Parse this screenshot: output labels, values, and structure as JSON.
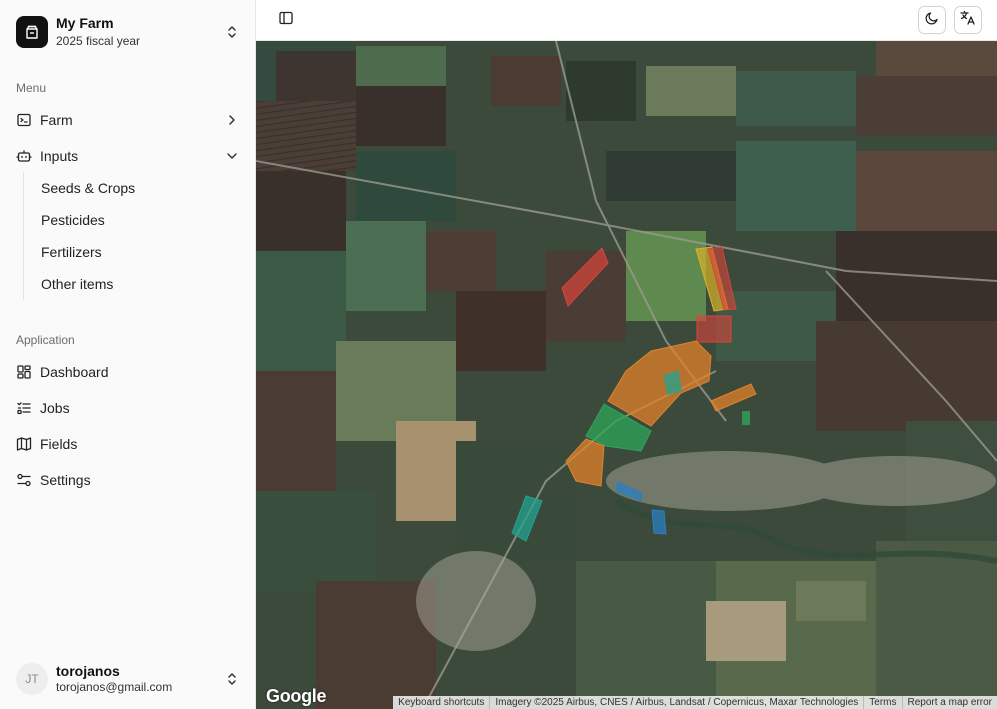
{
  "sidebar": {
    "farm": {
      "name": "My Farm",
      "subtitle": "2025 fiscal year"
    },
    "menu_label": "Menu",
    "menu": [
      {
        "label": "Farm",
        "icon": "terminal-square-icon",
        "chevron": "chevron-right-icon"
      },
      {
        "label": "Inputs",
        "icon": "bot-icon",
        "chevron": "chevron-down-icon",
        "children": [
          "Seeds & Crops",
          "Pesticides",
          "Fertilizers",
          "Other items"
        ]
      }
    ],
    "app_label": "Application",
    "app": [
      {
        "label": "Dashboard",
        "icon": "dashboard-grid-icon"
      },
      {
        "label": "Jobs",
        "icon": "list-todo-icon"
      },
      {
        "label": "Fields",
        "icon": "map-icon"
      },
      {
        "label": "Settings",
        "icon": "sliders-icon"
      }
    ],
    "user": {
      "initials": "JT",
      "name": "torojanos",
      "email": "torojanos@gmail.com"
    }
  },
  "topbar": {
    "toggle_icon": "panel-left-icon",
    "theme_icon": "moon-icon",
    "language_icon": "translate-icon"
  },
  "map": {
    "provider": "Google",
    "attribution": {
      "shortcuts": "Keyboard shortcuts",
      "imagery": "Imagery ©2025 Airbus, CNES / Airbus, Landsat / Copernicus, Maxar Technologies",
      "terms": "Terms",
      "report": "Report a map error"
    },
    "field_colors": {
      "red": "#d9443a",
      "yellow": "#d9b22a",
      "orange": "#e0822b",
      "green": "#2ea55a",
      "teal": "#22a38f",
      "blue": "#2b7fc0"
    }
  }
}
